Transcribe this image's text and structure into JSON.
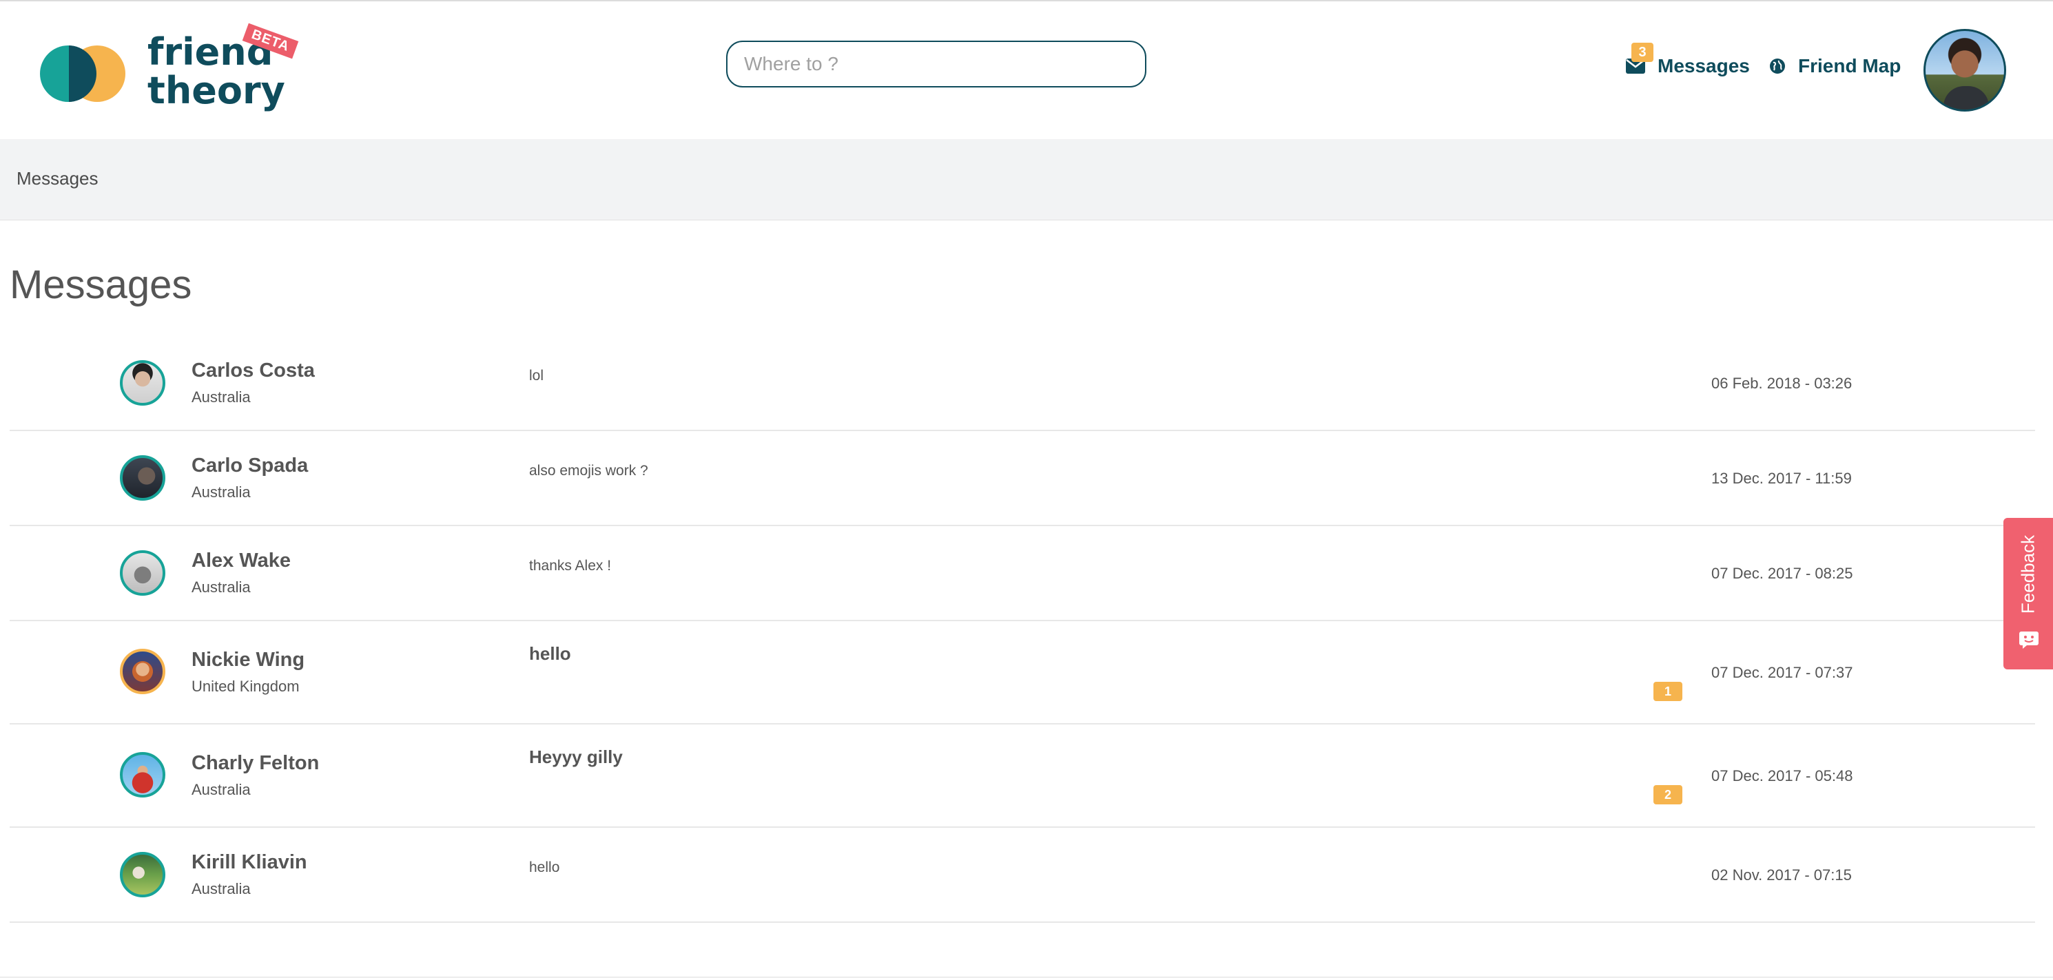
{
  "header": {
    "logo": {
      "line1": "friend",
      "line2": "theory",
      "badge": "BETA"
    },
    "search": {
      "placeholder": "Where to ?",
      "value": ""
    },
    "nav": {
      "messages_label": "Messages",
      "messages_count": "3",
      "friend_map_label": "Friend Map"
    },
    "user_avatar": "avatar"
  },
  "breadcrumb": {
    "current": "Messages"
  },
  "page_title": "Messages",
  "conversations": [
    {
      "name": "Carlos Costa",
      "location": "Australia",
      "message": "lol",
      "date": "06 Feb. 2018 - 03:26",
      "unread": "",
      "unread_flag": false
    },
    {
      "name": "Carlo Spada",
      "location": "Australia",
      "message": "also emojis work ?",
      "date": "13 Dec. 2017 - 11:59",
      "unread": "",
      "unread_flag": false
    },
    {
      "name": "Alex Wake",
      "location": "Australia",
      "message": "thanks Alex !",
      "date": "07 Dec. 2017 - 08:25",
      "unread": "",
      "unread_flag": false
    },
    {
      "name": "Nickie Wing",
      "location": "United Kingdom",
      "message": "hello",
      "date": "07 Dec. 2017 - 07:37",
      "unread": "1",
      "unread_flag": true
    },
    {
      "name": "Charly Felton",
      "location": "Australia",
      "message": "Heyyy gilly",
      "date": "07 Dec. 2017 - 05:48",
      "unread": "2",
      "unread_flag": true
    },
    {
      "name": "Kirill Kliavin",
      "location": "Australia",
      "message": "hello",
      "date": "02 Nov. 2017 - 07:15",
      "unread": "",
      "unread_flag": false
    }
  ],
  "feedback": {
    "label": "Feedback",
    "icon": "chat-smile-icon"
  },
  "colors": {
    "brand_dark": "#0f4c5c",
    "brand_teal": "#17a398",
    "brand_orange": "#f6b44e",
    "feedback_red": "#f0616f"
  }
}
